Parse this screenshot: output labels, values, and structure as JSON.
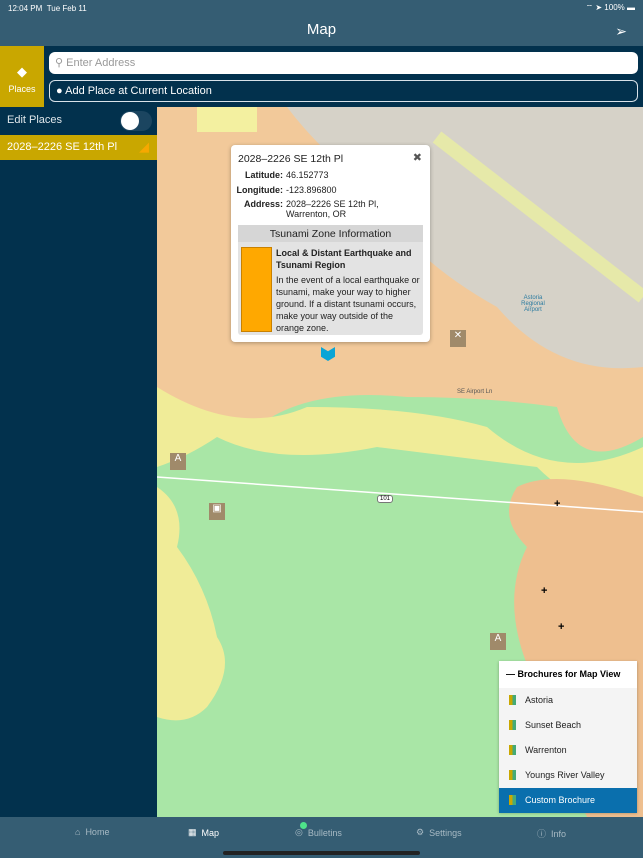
{
  "status": {
    "time": "12:04 PM",
    "date": "Tue Feb 11",
    "battery": "100%"
  },
  "nav": {
    "title": "Map"
  },
  "toolbar": {
    "places_label": "Places",
    "search_placeholder": "Enter Address",
    "add_place_label": "Add Place at Current Location"
  },
  "sidebar": {
    "edit_label": "Edit Places",
    "edit_on": false,
    "places": [
      {
        "label": "2028–2226 SE 12th Pl"
      }
    ]
  },
  "popup": {
    "title": "2028–2226 SE 12th Pl",
    "lat_label": "Latitude:",
    "lat": "46.152773",
    "lon_label": "Longitude:",
    "lon": "-123.896800",
    "addr_label": "Address:",
    "addr1": "2028–2226 SE 12th Pl,",
    "addr2": "Warrenton, OR",
    "zone_title": "Tsunami Zone Information",
    "zone_heading": "Local & Distant Earthquake and Tsunami Region",
    "zone_text": "In the event of a local earthquake or tsunami, make your way to higher ground. If a distant tsunami occurs, make your way outside of the orange zone.",
    "zone_color": "#ffa800"
  },
  "map_labels": {
    "airport": "Astoria Regional Airport",
    "road": "SE Airport Ln",
    "highway": "101"
  },
  "brochures": {
    "title": "Brochures for Map View",
    "items": [
      "Astoria",
      "Sunset Beach",
      "Warrenton",
      "Youngs River Valley",
      "Custom Brochure"
    ],
    "selected": "Custom Brochure"
  },
  "tabs": [
    {
      "label": "Home"
    },
    {
      "label": "Map"
    },
    {
      "label": "Bulletins"
    },
    {
      "label": "Settings"
    },
    {
      "label": "Info"
    }
  ]
}
